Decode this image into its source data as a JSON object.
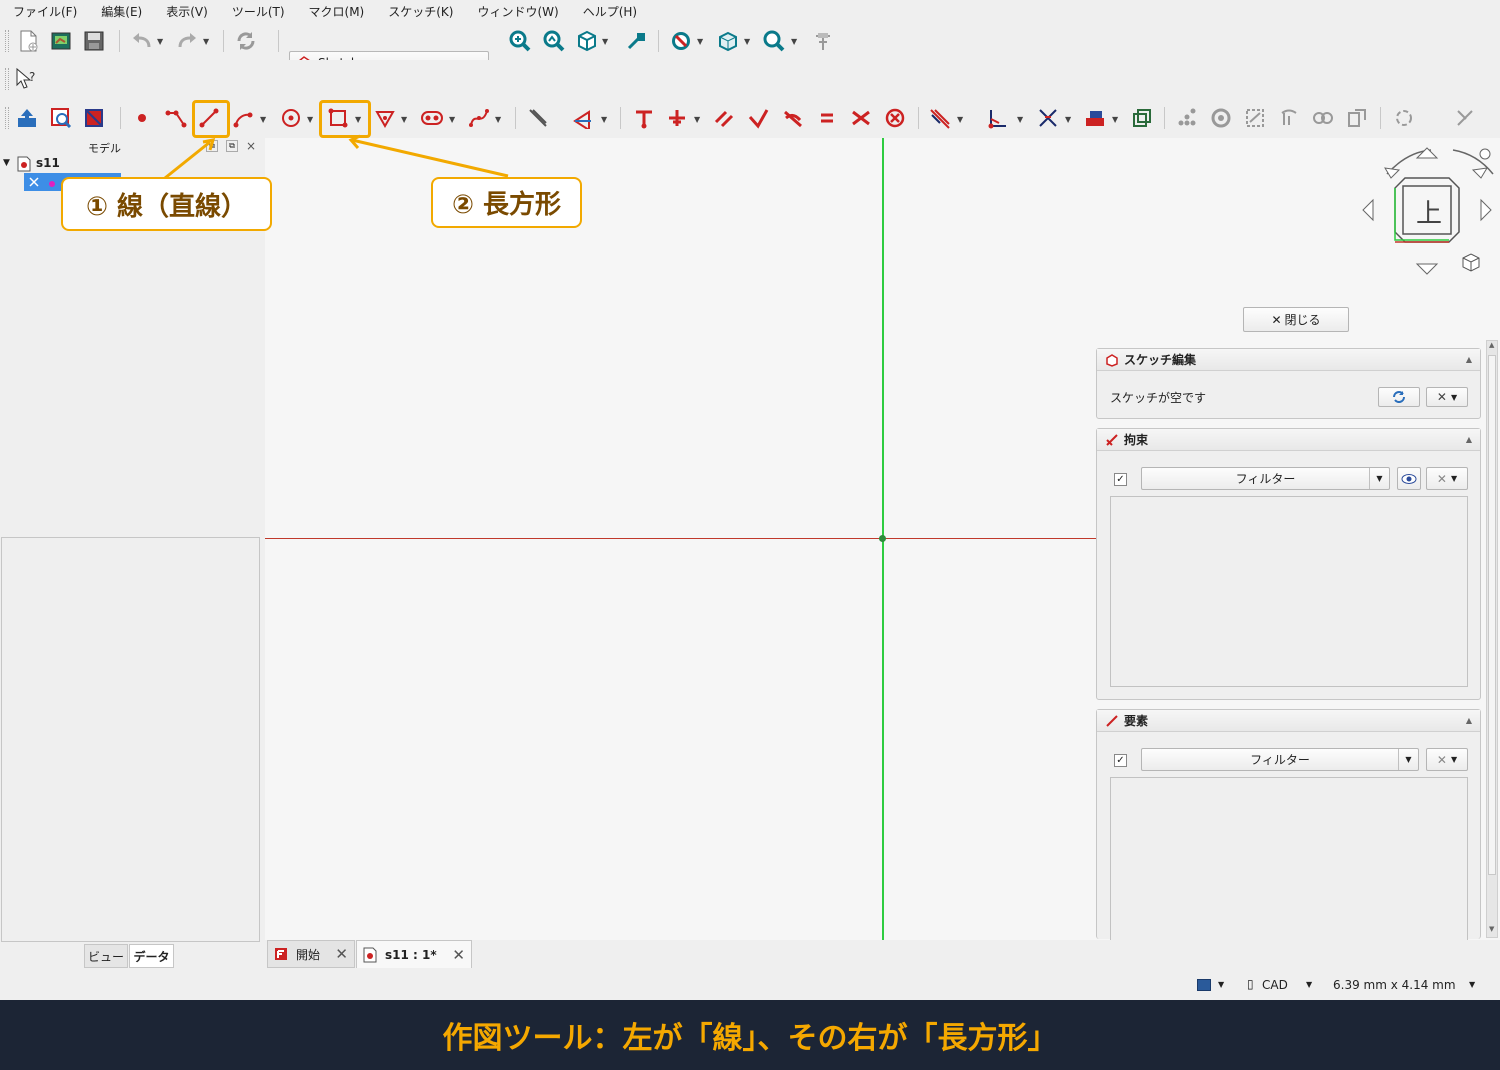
{
  "menu": [
    "ファイル(F)",
    "編集(E)",
    "表示(V)",
    "ツール(T)",
    "マクロ(M)",
    "スケッチ(K)",
    "ウィンドウ(W)",
    "ヘルプ(H)"
  ],
  "workbench": {
    "label": "Sketcher"
  },
  "left_panel": {
    "title": "モデル",
    "tree_item": "s11",
    "tabs": [
      "ビュー",
      "データ"
    ]
  },
  "callouts": {
    "line": "① 線（直線）",
    "rectangle": "② 長方形"
  },
  "navcube": {
    "face": "上"
  },
  "task": {
    "close_label": "閉じる",
    "sketch_edit": {
      "title": "スケッチ編集",
      "status": "スケッチが空です"
    },
    "constraints": {
      "title": "拘束",
      "filter": "フィルター",
      "checked": true
    },
    "elements": {
      "title": "要素",
      "filter": "フィルター",
      "checked": true
    }
  },
  "doc_tabs": [
    "開始",
    "s11 : 1*"
  ],
  "status": {
    "nav_style": "CAD",
    "dimensions": "6.39 mm x 4.14 mm"
  },
  "banner": "作図ツール：左が「線」、その右が「長方形」",
  "colors": {
    "accent": "#f2a900",
    "banner_bg": "#1c2535",
    "banner_text": "#f5a800",
    "x_axis": "#c0392b",
    "y_axis": "#2ecc40",
    "selection": "#3d8ee6"
  }
}
